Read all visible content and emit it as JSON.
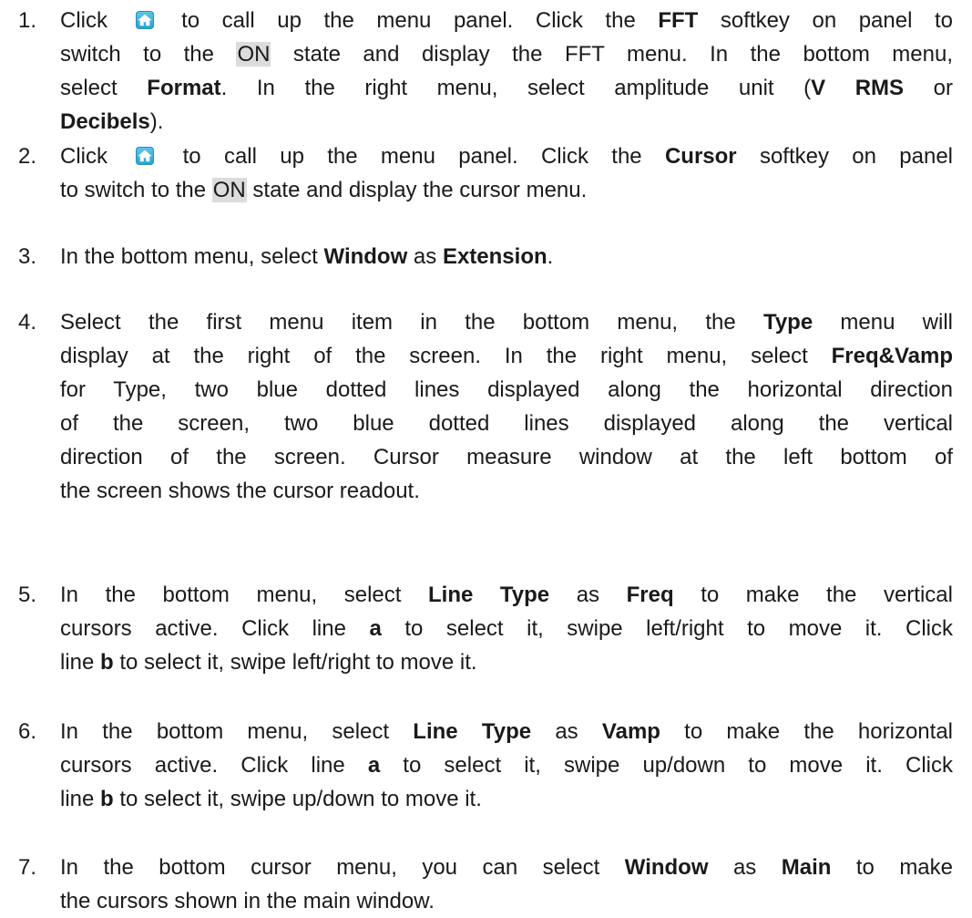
{
  "icons": {
    "home": "home-icon"
  },
  "steps": [
    {
      "num": "1.",
      "lines": [
        [
          "Click ",
          {
            "icon": "home"
          },
          " to call up the menu panel. Click the ",
          {
            "b": "FFT"
          },
          " softkey on panel to"
        ],
        [
          "switch to the ",
          {
            "hl": "ON"
          },
          " state and display the FFT menu. In the bottom menu,"
        ],
        [
          "select ",
          {
            "b": "Format"
          },
          ". In the right menu, select amplitude unit (",
          {
            "b": "V RMS"
          },
          " or"
        ],
        [
          {
            "b": "Decibels"
          },
          ")."
        ]
      ]
    },
    {
      "num": "2.",
      "lines": [
        [
          "Click ",
          {
            "icon": "home"
          },
          " to call up the menu panel. Click the ",
          {
            "b": "Cursor"
          },
          " softkey on panel"
        ],
        [
          "to switch to the ",
          {
            "hl": "ON"
          },
          " state and display the cursor menu."
        ]
      ]
    },
    {
      "num": "3.",
      "lines": [
        [
          "In the bottom menu, select ",
          {
            "b": "Window"
          },
          " as ",
          {
            "b": "Extension"
          },
          "."
        ]
      ]
    },
    {
      "num": "4.",
      "lines": [
        [
          "Select the first menu item in the bottom menu, the ",
          {
            "b": "Type"
          },
          " menu will"
        ],
        [
          "display at the right of the screen. In the right menu, select ",
          {
            "b": "Freq&Vamp"
          }
        ],
        [
          "for Type, two blue dotted lines displayed along the horizontal direction"
        ],
        [
          "of the screen, two blue dotted lines displayed along the vertical"
        ],
        [
          "direction of the screen. Cursor measure window at the left bottom of"
        ],
        [
          "the screen shows the cursor readout."
        ]
      ]
    },
    {
      "num": "5.",
      "lines": [
        [
          "In the bottom menu, select ",
          {
            "b": "Line Type"
          },
          " as ",
          {
            "b": "Freq"
          },
          " to make the vertical"
        ],
        [
          "cursors active. Click line ",
          {
            "b": "a"
          },
          " to select it, swipe left/right to move it. Click"
        ],
        [
          "line ",
          {
            "b": "b"
          },
          " to select it, swipe left/right to move it."
        ]
      ]
    },
    {
      "num": "6.",
      "lines": [
        [
          "In the bottom menu, select ",
          {
            "b": "Line Type"
          },
          " as ",
          {
            "b": "Vamp"
          },
          " to make the horizontal"
        ],
        [
          "cursors active. Click line ",
          {
            "b": "a"
          },
          " to select it, swipe up/down to move it. Click"
        ],
        [
          "line ",
          {
            "b": "b"
          },
          " to select it, swipe up/down to move it."
        ]
      ]
    },
    {
      "num": "7.",
      "lines": [
        [
          "In the bottom cursor menu, you can select ",
          {
            "b": "Window"
          },
          " as ",
          {
            "b": "Main"
          },
          " to make"
        ],
        [
          "the cursors shown in the main window."
        ]
      ]
    }
  ]
}
